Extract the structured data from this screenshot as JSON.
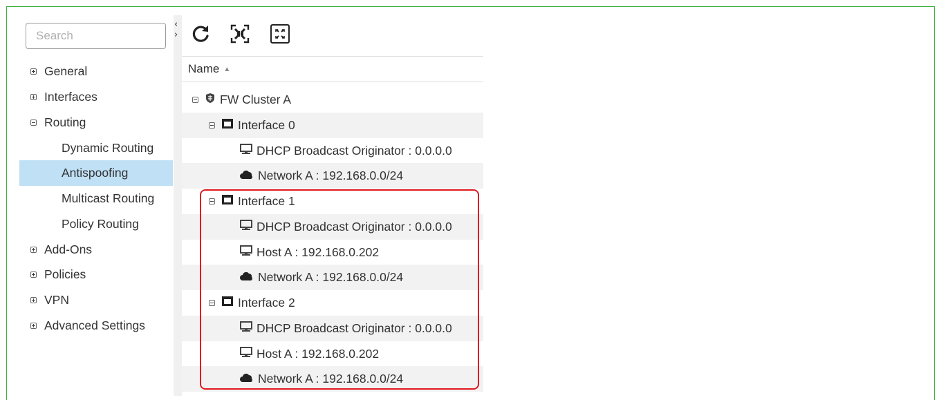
{
  "search": {
    "placeholder": "Search",
    "value": ""
  },
  "sidebar": {
    "items": [
      {
        "label": "General",
        "type": "top",
        "expanded": false
      },
      {
        "label": "Interfaces",
        "type": "top",
        "expanded": false
      },
      {
        "label": "Routing",
        "type": "top",
        "expanded": true
      },
      {
        "label": "Dynamic Routing",
        "type": "sub"
      },
      {
        "label": "Antispoofing",
        "type": "sub",
        "active": true
      },
      {
        "label": "Multicast Routing",
        "type": "sub"
      },
      {
        "label": "Policy Routing",
        "type": "sub"
      },
      {
        "label": "Add-Ons",
        "type": "top",
        "expanded": false
      },
      {
        "label": "Policies",
        "type": "top",
        "expanded": false
      },
      {
        "label": "VPN",
        "type": "top",
        "expanded": false
      },
      {
        "label": "Advanced Settings",
        "type": "top",
        "expanded": false
      }
    ]
  },
  "collapse_arrows": {
    "left": "‹",
    "right": "›"
  },
  "toolbar": {
    "icons": [
      "refresh-icon",
      "collapse-all-icon",
      "expand-all-icon"
    ]
  },
  "table": {
    "header": {
      "name": "Name",
      "sort": "▲"
    },
    "rows": [
      {
        "label": "FW Cluster A",
        "level": 0,
        "icon": "firewall-cluster-icon"
      },
      {
        "label": "Interface 0",
        "level": 1,
        "icon": "interface-icon"
      },
      {
        "label": "DHCP Broadcast Originator : 0.0.0.0",
        "level": 2,
        "icon": "host-icon"
      },
      {
        "label": "Network A : 192.168.0.0/24",
        "level": 2,
        "icon": "network-cloud-icon"
      },
      {
        "label": "Interface 1",
        "level": 1,
        "icon": "interface-icon"
      },
      {
        "label": "DHCP Broadcast Originator : 0.0.0.0",
        "level": 2,
        "icon": "host-icon"
      },
      {
        "label": "Host A : 192.168.0.202",
        "level": 2,
        "icon": "host-icon"
      },
      {
        "label": "Network A : 192.168.0.0/24",
        "level": 2,
        "icon": "network-cloud-icon"
      },
      {
        "label": "Interface 2",
        "level": 1,
        "icon": "interface-icon"
      },
      {
        "label": "DHCP Broadcast Originator : 0.0.0.0",
        "level": 2,
        "icon": "host-icon"
      },
      {
        "label": "Host A : 192.168.0.202",
        "level": 2,
        "icon": "host-icon"
      },
      {
        "label": "Network A : 192.168.0.0/24",
        "level": 2,
        "icon": "network-cloud-icon"
      }
    ]
  },
  "colors": {
    "frame_border": "#3fae3f",
    "active_item_bg": "#bfe0f5",
    "highlight_border": "#e0191f"
  }
}
